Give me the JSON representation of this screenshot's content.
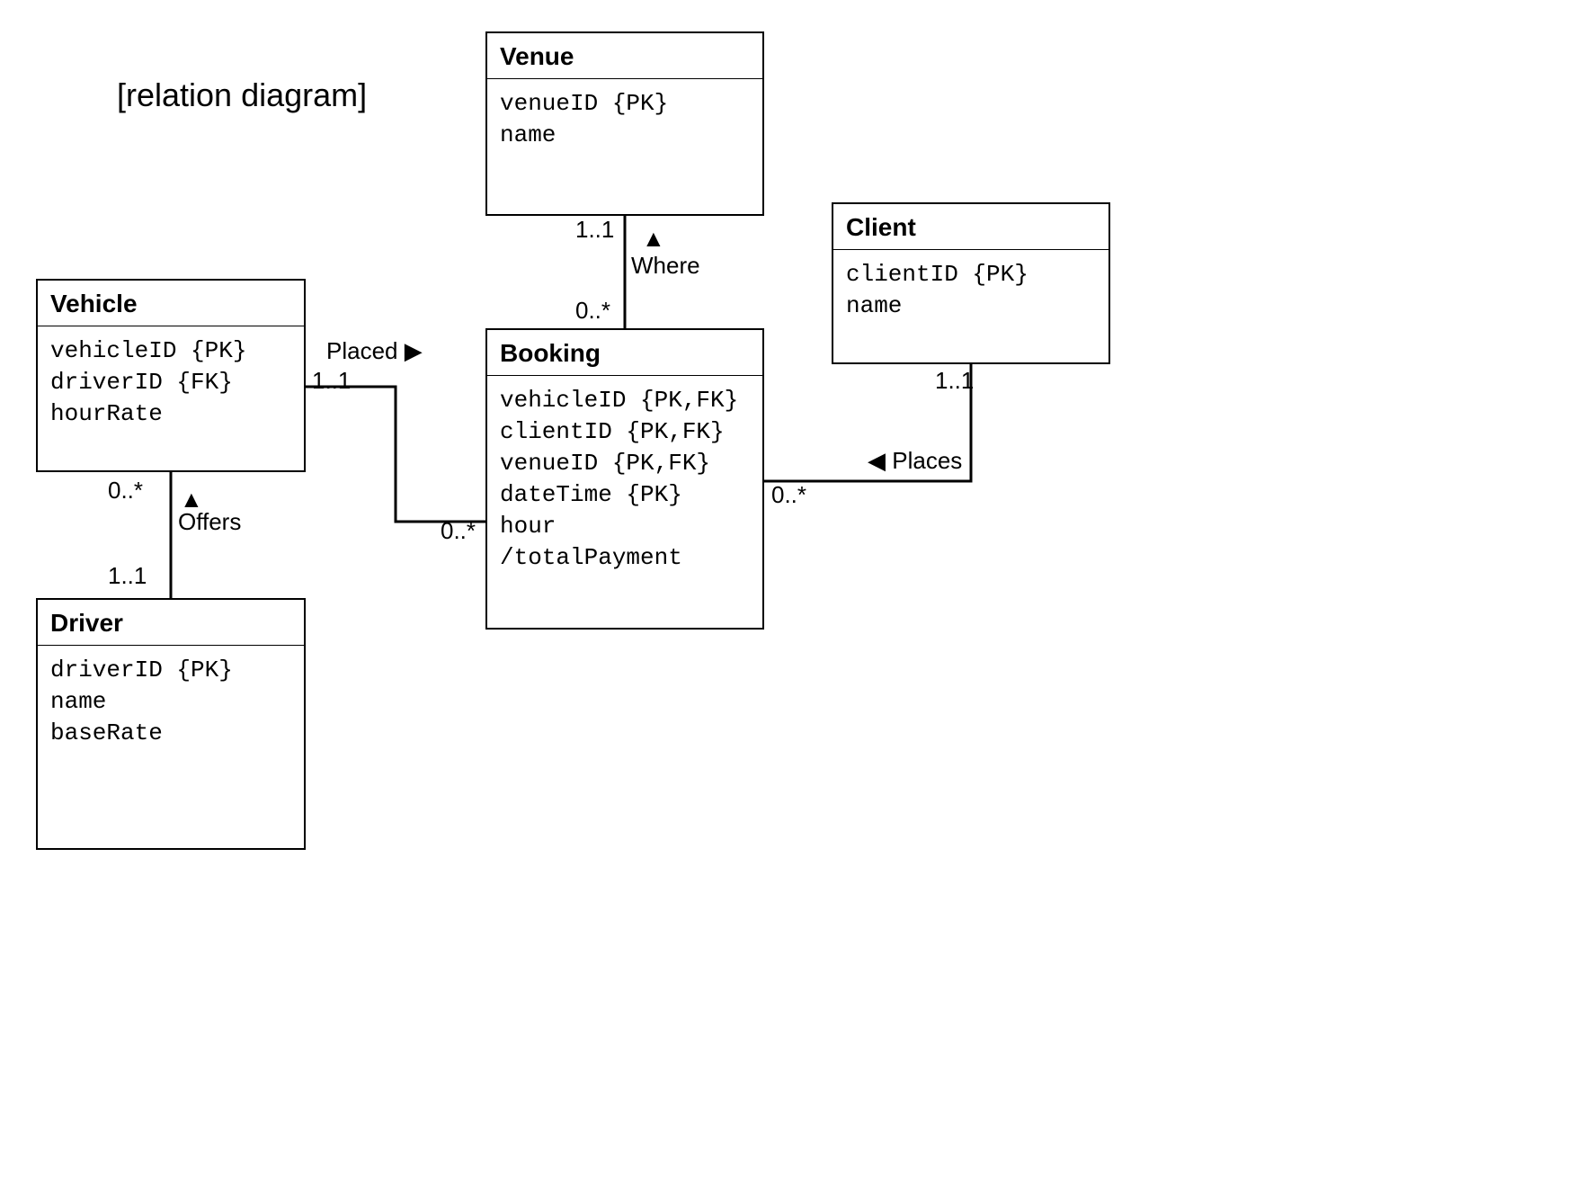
{
  "title": "[relation diagram]",
  "entities": {
    "vehicle": {
      "name": "Vehicle",
      "attrs": [
        "vehicleID {PK}",
        "driverID {FK}",
        "hourRate"
      ]
    },
    "driver": {
      "name": "Driver",
      "attrs": [
        "driverID {PK}",
        "name",
        "baseRate"
      ]
    },
    "venue": {
      "name": "Venue",
      "attrs": [
        "venueID {PK}",
        "name"
      ]
    },
    "booking": {
      "name": "Booking",
      "attrs": [
        "vehicleID {PK,FK}",
        "clientID {PK,FK}",
        "venueID {PK,FK}",
        "dateTime {PK}",
        "hour",
        "/totalPayment"
      ]
    },
    "client": {
      "name": "Client",
      "attrs": [
        "clientID {PK}",
        "name"
      ]
    }
  },
  "relations": {
    "placed": {
      "label": "Placed",
      "arrow": "▶",
      "m1": "1..1",
      "m2": "0..*"
    },
    "offers": {
      "label": "Offers",
      "arrow": "▲",
      "m1": "0..*",
      "m2": "1..1"
    },
    "where": {
      "label": "Where",
      "arrow": "▲",
      "m1": "1..1",
      "m2": "0..*"
    },
    "places": {
      "label": "Places",
      "arrow": "◀",
      "m1": "0..*",
      "m2": "1..1"
    }
  }
}
